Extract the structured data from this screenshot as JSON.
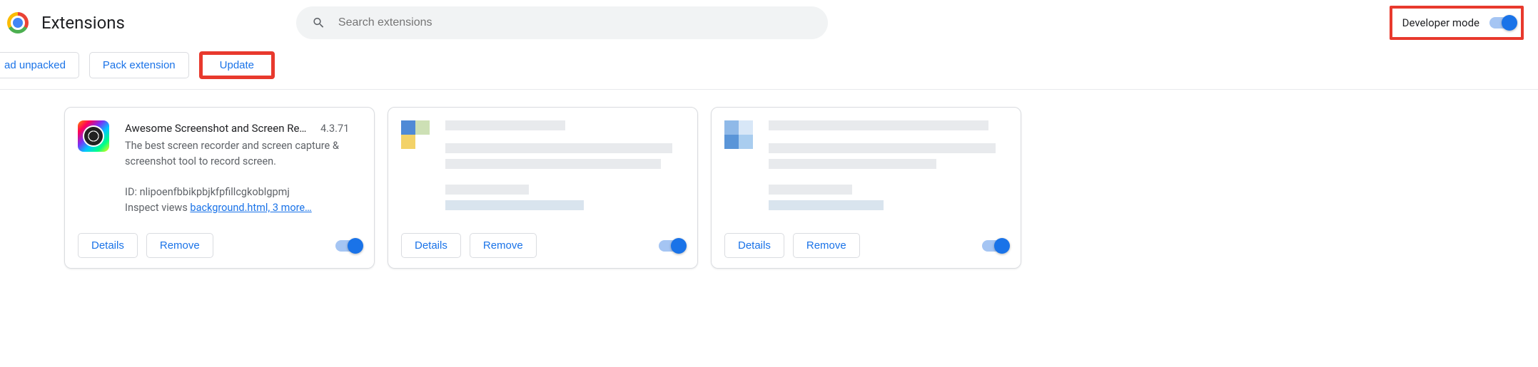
{
  "header": {
    "title": "Extensions",
    "search_placeholder": "Search extensions",
    "dev_mode_label": "Developer mode",
    "dev_mode_on": true
  },
  "toolbar": {
    "load_unpacked_label": "ad unpacked",
    "pack_extension_label": "Pack extension",
    "update_label": "Update",
    "update_highlighted": true
  },
  "card_actions": {
    "details_label": "Details",
    "remove_label": "Remove"
  },
  "extensions": [
    {
      "name": "Awesome Screenshot and Screen Recor…",
      "version": "4.3.71",
      "description": "The best screen recorder and screen capture & screenshot tool to record screen.",
      "id_prefix": "ID: ",
      "id": "nlipoenfbbikpbjkfpfillcgkoblgpmj",
      "inspect_prefix": "Inspect views ",
      "inspect_link": "background.html, 3 more…",
      "enabled": true,
      "obscured": false
    },
    {
      "name": "",
      "version": "",
      "description": "",
      "id": "",
      "inspect_link": "",
      "enabled": true,
      "obscured": true
    },
    {
      "name": "",
      "version": "",
      "description": "",
      "id": "",
      "inspect_link": "",
      "enabled": true,
      "obscured": true
    }
  ],
  "annotations": {
    "dev_mode_highlighted": true
  }
}
